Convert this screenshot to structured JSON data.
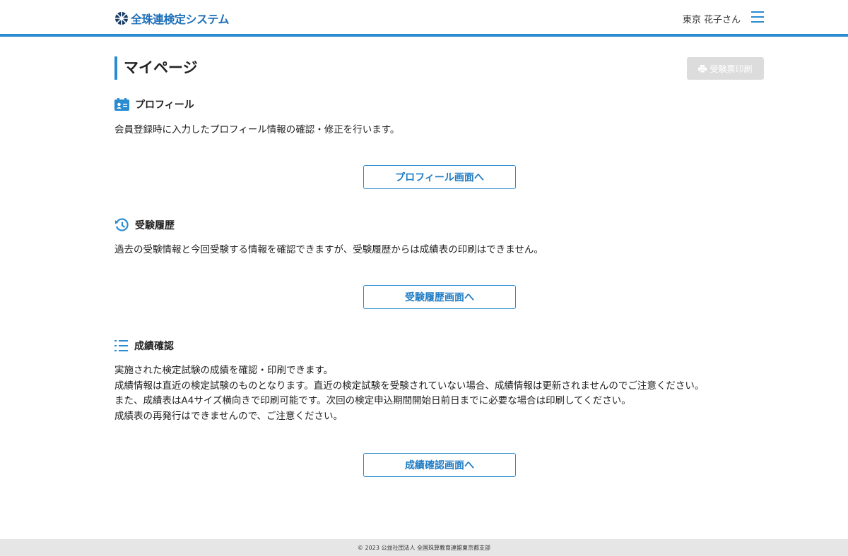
{
  "header": {
    "logo_text": "全珠連検定システム",
    "user_name": "東京 花子さん"
  },
  "page": {
    "title": "マイページ",
    "print_button_label": "受験票印刷"
  },
  "sections": {
    "profile": {
      "heading": "プロフィール",
      "description": "会員登録時に入力したプロフィール情報の確認・修正を行います。",
      "button_label": "プロフィール画面へ"
    },
    "history": {
      "heading": "受験履歴",
      "description": "過去の受験情報と今回受験する情報を確認できますが、受験履歴からは成績表の印刷はできません。",
      "button_label": "受験履歴画面へ"
    },
    "results": {
      "heading": "成績確認",
      "lines": [
        "実施された検定試験の成績を確認・印刷できます。",
        "成績情報は直近の検定試験のものとなります。直近の検定試験を受験されていない場合、成績情報は更新されませんのでご注意ください。",
        "また、成績表はA4サイズ横向きで印刷可能です。次回の検定申込期間開始日前日までに必要な場合は印刷してください。",
        "成績表の再発行はできませんので、ご注意ください。"
      ],
      "button_label": "成績確認画面へ"
    }
  },
  "footer": {
    "copyright": "© 2023 公益社団法人 全国珠算教育連盟東京都支部"
  },
  "colors": {
    "accent": "#2a8bd0",
    "button_text": "#1f7cc4",
    "disabled_button": "#dcdcdc",
    "footer_bg": "#e6e6e6"
  }
}
